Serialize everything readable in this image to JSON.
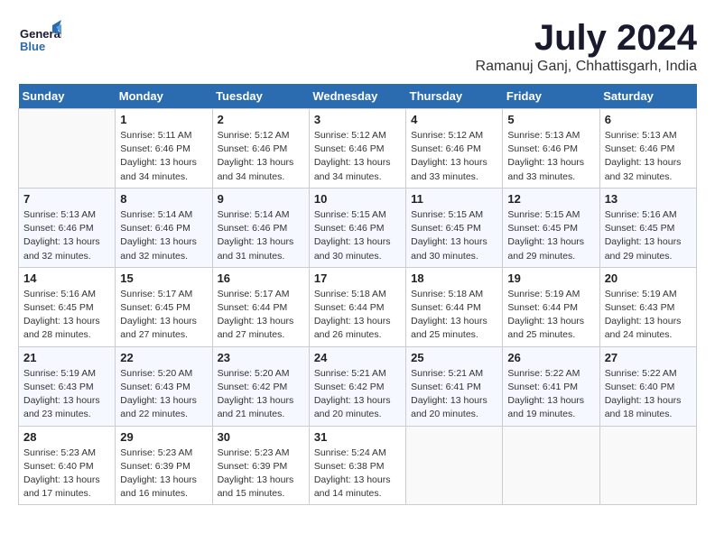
{
  "logo": {
    "line1": "General",
    "line2": "Blue"
  },
  "title": "July 2024",
  "location": "Ramanuj Ganj, Chhattisgarh, India",
  "days_of_week": [
    "Sunday",
    "Monday",
    "Tuesday",
    "Wednesday",
    "Thursday",
    "Friday",
    "Saturday"
  ],
  "weeks": [
    [
      {
        "day": "",
        "info": ""
      },
      {
        "day": "1",
        "info": "Sunrise: 5:11 AM\nSunset: 6:46 PM\nDaylight: 13 hours\nand 34 minutes."
      },
      {
        "day": "2",
        "info": "Sunrise: 5:12 AM\nSunset: 6:46 PM\nDaylight: 13 hours\nand 34 minutes."
      },
      {
        "day": "3",
        "info": "Sunrise: 5:12 AM\nSunset: 6:46 PM\nDaylight: 13 hours\nand 34 minutes."
      },
      {
        "day": "4",
        "info": "Sunrise: 5:12 AM\nSunset: 6:46 PM\nDaylight: 13 hours\nand 33 minutes."
      },
      {
        "day": "5",
        "info": "Sunrise: 5:13 AM\nSunset: 6:46 PM\nDaylight: 13 hours\nand 33 minutes."
      },
      {
        "day": "6",
        "info": "Sunrise: 5:13 AM\nSunset: 6:46 PM\nDaylight: 13 hours\nand 32 minutes."
      }
    ],
    [
      {
        "day": "7",
        "info": "Sunrise: 5:13 AM\nSunset: 6:46 PM\nDaylight: 13 hours\nand 32 minutes."
      },
      {
        "day": "8",
        "info": "Sunrise: 5:14 AM\nSunset: 6:46 PM\nDaylight: 13 hours\nand 32 minutes."
      },
      {
        "day": "9",
        "info": "Sunrise: 5:14 AM\nSunset: 6:46 PM\nDaylight: 13 hours\nand 31 minutes."
      },
      {
        "day": "10",
        "info": "Sunrise: 5:15 AM\nSunset: 6:46 PM\nDaylight: 13 hours\nand 30 minutes."
      },
      {
        "day": "11",
        "info": "Sunrise: 5:15 AM\nSunset: 6:45 PM\nDaylight: 13 hours\nand 30 minutes."
      },
      {
        "day": "12",
        "info": "Sunrise: 5:15 AM\nSunset: 6:45 PM\nDaylight: 13 hours\nand 29 minutes."
      },
      {
        "day": "13",
        "info": "Sunrise: 5:16 AM\nSunset: 6:45 PM\nDaylight: 13 hours\nand 29 minutes."
      }
    ],
    [
      {
        "day": "14",
        "info": "Sunrise: 5:16 AM\nSunset: 6:45 PM\nDaylight: 13 hours\nand 28 minutes."
      },
      {
        "day": "15",
        "info": "Sunrise: 5:17 AM\nSunset: 6:45 PM\nDaylight: 13 hours\nand 27 minutes."
      },
      {
        "day": "16",
        "info": "Sunrise: 5:17 AM\nSunset: 6:44 PM\nDaylight: 13 hours\nand 27 minutes."
      },
      {
        "day": "17",
        "info": "Sunrise: 5:18 AM\nSunset: 6:44 PM\nDaylight: 13 hours\nand 26 minutes."
      },
      {
        "day": "18",
        "info": "Sunrise: 5:18 AM\nSunset: 6:44 PM\nDaylight: 13 hours\nand 25 minutes."
      },
      {
        "day": "19",
        "info": "Sunrise: 5:19 AM\nSunset: 6:44 PM\nDaylight: 13 hours\nand 25 minutes."
      },
      {
        "day": "20",
        "info": "Sunrise: 5:19 AM\nSunset: 6:43 PM\nDaylight: 13 hours\nand 24 minutes."
      }
    ],
    [
      {
        "day": "21",
        "info": "Sunrise: 5:19 AM\nSunset: 6:43 PM\nDaylight: 13 hours\nand 23 minutes."
      },
      {
        "day": "22",
        "info": "Sunrise: 5:20 AM\nSunset: 6:43 PM\nDaylight: 13 hours\nand 22 minutes."
      },
      {
        "day": "23",
        "info": "Sunrise: 5:20 AM\nSunset: 6:42 PM\nDaylight: 13 hours\nand 21 minutes."
      },
      {
        "day": "24",
        "info": "Sunrise: 5:21 AM\nSunset: 6:42 PM\nDaylight: 13 hours\nand 20 minutes."
      },
      {
        "day": "25",
        "info": "Sunrise: 5:21 AM\nSunset: 6:41 PM\nDaylight: 13 hours\nand 20 minutes."
      },
      {
        "day": "26",
        "info": "Sunrise: 5:22 AM\nSunset: 6:41 PM\nDaylight: 13 hours\nand 19 minutes."
      },
      {
        "day": "27",
        "info": "Sunrise: 5:22 AM\nSunset: 6:40 PM\nDaylight: 13 hours\nand 18 minutes."
      }
    ],
    [
      {
        "day": "28",
        "info": "Sunrise: 5:23 AM\nSunset: 6:40 PM\nDaylight: 13 hours\nand 17 minutes."
      },
      {
        "day": "29",
        "info": "Sunrise: 5:23 AM\nSunset: 6:39 PM\nDaylight: 13 hours\nand 16 minutes."
      },
      {
        "day": "30",
        "info": "Sunrise: 5:23 AM\nSunset: 6:39 PM\nDaylight: 13 hours\nand 15 minutes."
      },
      {
        "day": "31",
        "info": "Sunrise: 5:24 AM\nSunset: 6:38 PM\nDaylight: 13 hours\nand 14 minutes."
      },
      {
        "day": "",
        "info": ""
      },
      {
        "day": "",
        "info": ""
      },
      {
        "day": "",
        "info": ""
      }
    ]
  ]
}
